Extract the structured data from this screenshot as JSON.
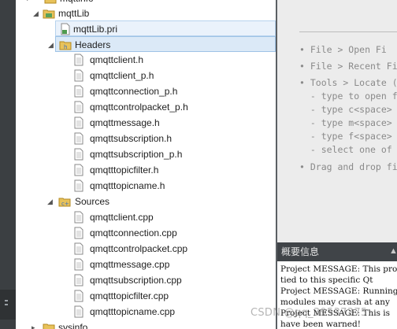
{
  "tree": {
    "partial_top_label": "mqttinfo",
    "project_label": "mqttLib",
    "pri_file": "mqttLib.pri",
    "headers_label": "Headers",
    "headers": [
      "qmqttclient.h",
      "qmqttclient_p.h",
      "qmqttconnection_p.h",
      "qmqttcontrolpacket_p.h",
      "qmqttmessage.h",
      "qmqttsubscription.h",
      "qmqttsubscription_p.h",
      "qmqtttopicfilter.h",
      "qmqtttopicname.h"
    ],
    "sources_label": "Sources",
    "sources": [
      "qmqttclient.cpp",
      "qmqttconnection.cpp",
      "qmqttcontrolpacket.cpp",
      "qmqttmessage.cpp",
      "qmqttsubscription.cpp",
      "qmqtttopicfilter.cpp",
      "qmqtttopicname.cpp"
    ],
    "bottom_label": "sysinfo"
  },
  "welcome_hints": [
    "• File > Open Fi",
    "• File > Recent Fi",
    "• Tools > Locate (",
    "  - type to open f",
    "  - type c<space>",
    "  - type m<space>",
    "  - type f<space>",
    "  - select one of",
    "• Drag and drop fi"
  ],
  "output_panel": {
    "title": "概要信息",
    "lines": [
      "Project MESSAGE: This pro",
      "tied to this specific Qt",
      "Project MESSAGE: Running",
      "modules may crash at any",
      "Project MESSAGE: This is",
      "have been warned!"
    ]
  },
  "watermark": "CSDN @qq_39537375",
  "colors": {
    "selection": "#dbe9f7",
    "panel_bar": "#404448",
    "sidebar": "#3b3f42"
  }
}
